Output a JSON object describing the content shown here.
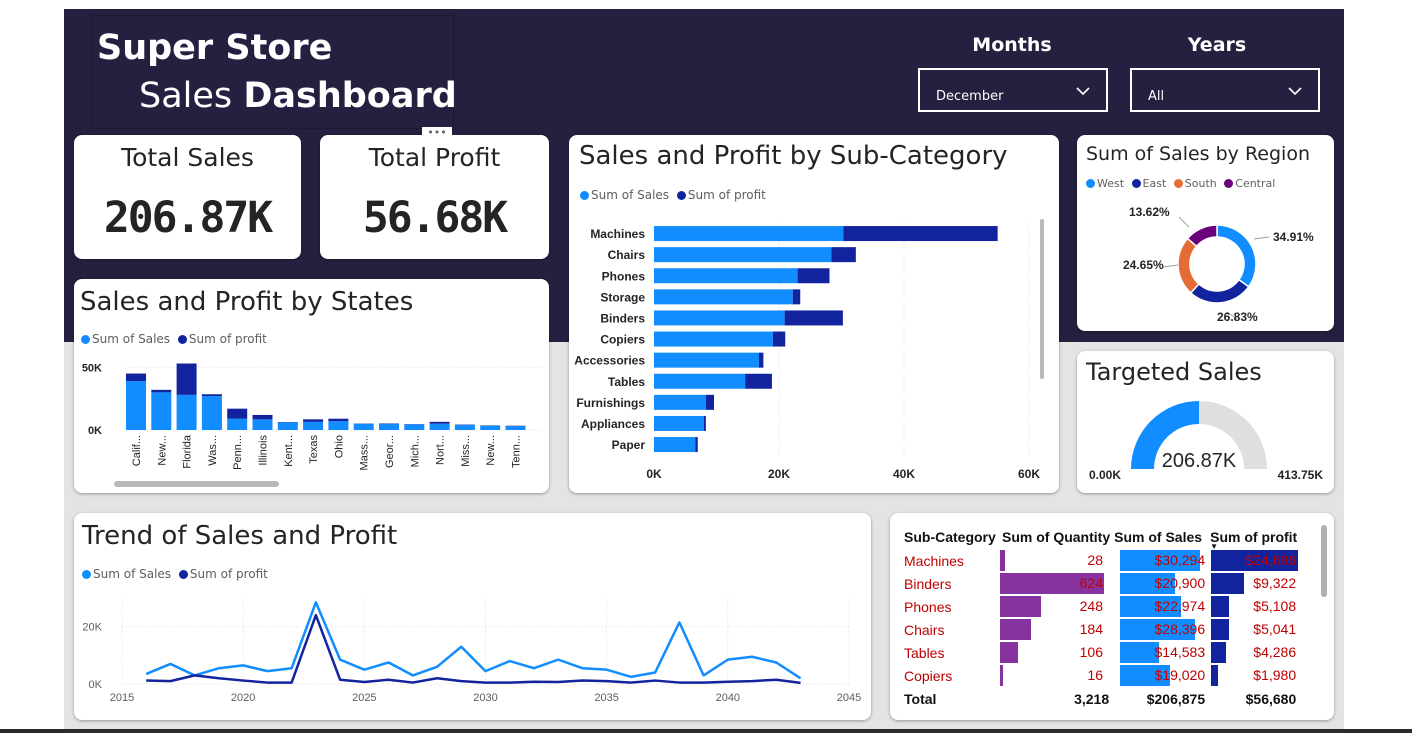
{
  "header": {
    "title_line1": "Super Store",
    "title_line2_pre": "Sales",
    "title_line2_bold": "Dashboard"
  },
  "slicers": [
    {
      "label": "Months",
      "value": "December"
    },
    {
      "label": "Years",
      "value": "All"
    }
  ],
  "kpis": {
    "total_sales": {
      "title": "Total Sales",
      "value": "206.87K"
    },
    "total_profit": {
      "title": "Total Profit",
      "value": "56.68K"
    }
  },
  "more_options": "•••",
  "colors": {
    "sales": "#118dff",
    "profit": "#12239e",
    "banner": "#262040",
    "matrix_qty": "#8633a0",
    "negative": "#c00000"
  },
  "chart_data": [
    {
      "type": "bar",
      "title": "Sales and Profit by States",
      "stacked": true,
      "series": [
        {
          "name": "Sum of Sales"
        },
        {
          "name": "Sum of profit"
        }
      ],
      "categories": [
        "Calif...",
        "New...",
        "Florida",
        "Was...",
        "Penn...",
        "Illinois",
        "Kent...",
        "Texas",
        "Ohio",
        "Mass...",
        "Geor...",
        "Mich...",
        "Nort...",
        "Miss...",
        "New...",
        "Tenn..."
      ],
      "sales": [
        39000,
        30000,
        28000,
        27000,
        9000,
        8500,
        6000,
        6500,
        7000,
        5000,
        5000,
        4500,
        5000,
        4000,
        3500,
        3000
      ],
      "profit": [
        6000,
        2000,
        25000,
        1500,
        8000,
        3500,
        300,
        2000,
        2000,
        200,
        300,
        200,
        1500,
        300,
        200,
        400
      ],
      "yticks": [
        "0K",
        "50K"
      ],
      "ylim": [
        0,
        55000
      ]
    },
    {
      "type": "bar",
      "title": "Sales and Profit by Sub-Category",
      "orientation": "horizontal",
      "stacked": true,
      "series": [
        {
          "name": "Sum of Sales"
        },
        {
          "name": "Sum of profit"
        }
      ],
      "categories": [
        "Machines",
        "Chairs",
        "Phones",
        "Storage",
        "Binders",
        "Copiers",
        "Accessories",
        "Tables",
        "Furnishings",
        "Appliances",
        "Paper"
      ],
      "sales": [
        30294,
        28396,
        22974,
        22200,
        20900,
        19020,
        16800,
        14583,
        8300,
        8000,
        6600
      ],
      "profit": [
        24686,
        3900,
        5108,
        1200,
        9322,
        1980,
        700,
        4286,
        1300,
        300,
        400
      ],
      "xticks": [
        "0K",
        "20K",
        "40K",
        "60K"
      ],
      "xlim": [
        0,
        60000
      ]
    },
    {
      "type": "pie",
      "title": "Sum of Sales by Region",
      "donut": true,
      "labels": [
        "West",
        "East",
        "South",
        "Central"
      ],
      "values": [
        34.91,
        26.83,
        24.65,
        13.62
      ],
      "value_labels": [
        "34.91%",
        "26.83%",
        "24.65%",
        "13.62%"
      ],
      "colors": [
        "#118dff",
        "#12239e",
        "#e66c37",
        "#6b007b"
      ]
    },
    {
      "type": "gauge",
      "title": "Targeted Sales",
      "value": 206.87,
      "min": 0,
      "max": 413.75,
      "value_label": "206.87K",
      "min_label": "0.00K",
      "max_label": "413.75K"
    },
    {
      "type": "line",
      "title": "Trend of Sales and Profit",
      "series": [
        {
          "name": "Sum of Sales"
        },
        {
          "name": "Sum of profit"
        }
      ],
      "x": [
        2016,
        2017,
        2018,
        2019,
        2020,
        2021,
        2022,
        2023,
        2024,
        2025,
        2026,
        2027,
        2028,
        2029,
        2030,
        2031,
        2032,
        2033,
        2034,
        2035,
        2036,
        2037,
        2038,
        2039,
        2040,
        2041,
        2042,
        2043
      ],
      "sales": [
        3500,
        7000,
        3000,
        5500,
        6500,
        4500,
        5500,
        28500,
        8500,
        5000,
        7500,
        3000,
        6000,
        13000,
        4500,
        8000,
        5500,
        8500,
        5500,
        5000,
        2500,
        4000,
        21500,
        3000,
        8500,
        9500,
        7500,
        2000
      ],
      "profit": [
        1200,
        1000,
        3000,
        2000,
        1200,
        500,
        500,
        24000,
        1500,
        700,
        1500,
        500,
        2000,
        1000,
        500,
        500,
        800,
        700,
        1200,
        1000,
        500,
        1200,
        500,
        500,
        800,
        1000,
        1500,
        400
      ],
      "xticks": [
        "2015",
        "2020",
        "2025",
        "2030",
        "2035",
        "2040",
        "2045"
      ],
      "yticks": [
        "0K",
        "20K"
      ],
      "xlim": [
        2015,
        2045
      ],
      "ylim": [
        0,
        30000
      ]
    },
    {
      "type": "table",
      "columns": [
        "Sub-Category",
        "Sum of Quantity",
        "Sum of Sales",
        "Sum of profit"
      ],
      "rows": [
        {
          "sub": "Machines",
          "qty": 28,
          "qty_label": "28",
          "sales": 30294,
          "sales_label": "$30,294",
          "profit": 24686,
          "profit_label": "$24,686"
        },
        {
          "sub": "Binders",
          "qty": 624,
          "qty_label": "624",
          "sales": 20900,
          "sales_label": "$20,900",
          "profit": 9322,
          "profit_label": "$9,322"
        },
        {
          "sub": "Phones",
          "qty": 248,
          "qty_label": "248",
          "sales": 22974,
          "sales_label": "$22,974",
          "profit": 5108,
          "profit_label": "$5,108"
        },
        {
          "sub": "Chairs",
          "qty": 184,
          "qty_label": "184",
          "sales": 28396,
          "sales_label": "$28,396",
          "profit": 5041,
          "profit_label": "$5,041"
        },
        {
          "sub": "Tables",
          "qty": 106,
          "qty_label": "106",
          "sales": 14583,
          "sales_label": "$14,583",
          "profit": 4286,
          "profit_label": "$4,286"
        },
        {
          "sub": "Copiers",
          "qty": 16,
          "qty_label": "16",
          "sales": 19020,
          "sales_label": "$19,020",
          "profit": 1980,
          "profit_label": "$1,980"
        }
      ],
      "total": {
        "label": "Total",
        "qty": "3,218",
        "sales": "$206,875",
        "profit": "$56,680"
      }
    }
  ]
}
